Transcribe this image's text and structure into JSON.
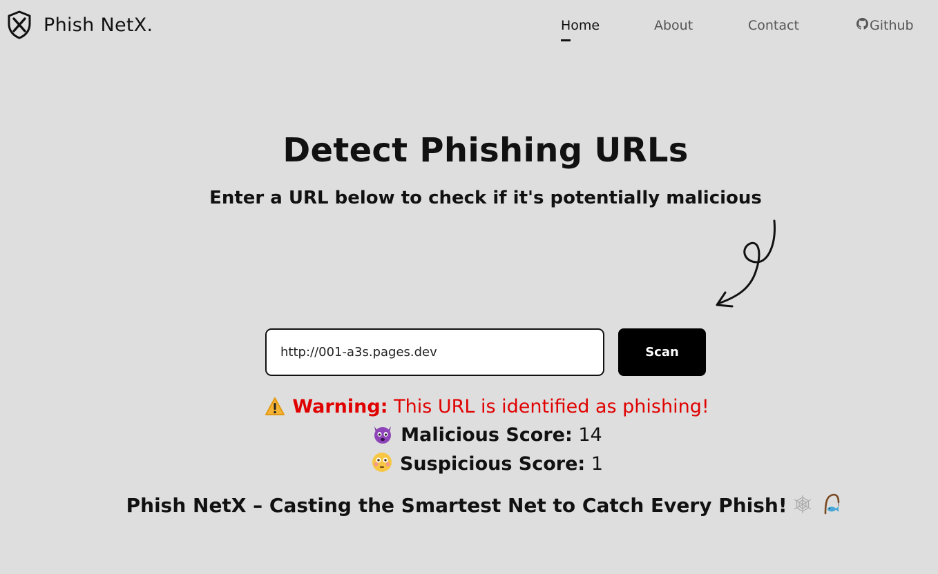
{
  "app": {
    "name": "Phish NetX.",
    "logo_icon": "shield-x-icon"
  },
  "nav": {
    "items": [
      {
        "label": "Home",
        "active": true
      },
      {
        "label": "About",
        "active": false
      },
      {
        "label": "Contact",
        "active": false
      },
      {
        "label": "Github",
        "active": false,
        "icon": "github-icon"
      }
    ]
  },
  "hero": {
    "title": "Detect Phishing URLs",
    "subtitle": "Enter a URL below to check if it's potentially malicious"
  },
  "form": {
    "url_value": "http://001-a3s.pages.dev",
    "scan_label": "Scan"
  },
  "result": {
    "warning_icon": "warning-icon",
    "warning_label": "Warning:",
    "warning_text": "This URL is identified as phishing!",
    "malicious_icon": "devil-face-icon",
    "malicious_label": "Malicious Score:",
    "malicious_score": "14",
    "suspicious_icon": "flushed-face-icon",
    "suspicious_label": "Suspicious Score:",
    "suspicious_score": "1"
  },
  "tagline": {
    "text": "Phish NetX – Casting the Smartest Net to Catch Every Phish!",
    "icons": [
      "spider-web-icon",
      "fishing-icon"
    ]
  },
  "colors": {
    "background": "#dedede",
    "warning": "#e00000",
    "button": "#000000"
  }
}
